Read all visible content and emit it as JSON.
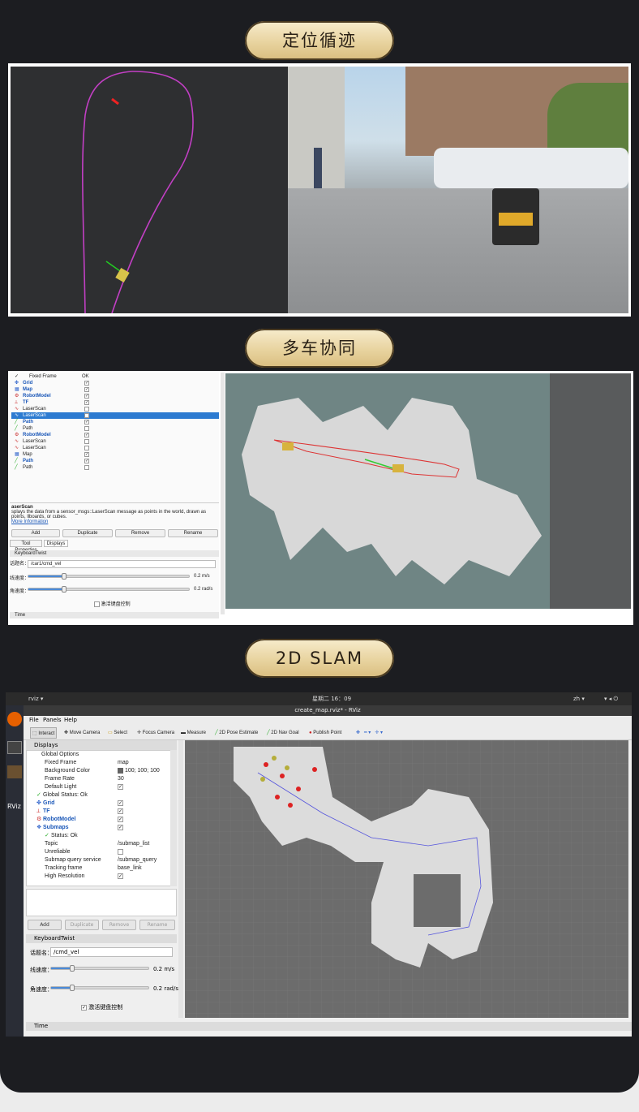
{
  "sections": [
    {
      "title": "定位循迹"
    },
    {
      "title": "多车协同"
    },
    {
      "title": "2D SLAM"
    }
  ],
  "panel2": {
    "display_rows": [
      {
        "name": "Fixed Frame",
        "value": "OK"
      },
      {
        "name": "Grid",
        "checked": "✓"
      },
      {
        "name": "Map",
        "checked": "✓"
      },
      {
        "name": "RobotModel",
        "checked": "✓"
      },
      {
        "name": "TF",
        "checked": "✓"
      },
      {
        "name": "LaserScan",
        "checked": ""
      },
      {
        "name": "LaserScan",
        "checked": ""
      },
      {
        "name": "Path",
        "checked": "✓"
      },
      {
        "name": "Path",
        "checked": ""
      },
      {
        "name": "RobotModel",
        "checked": "✓"
      },
      {
        "name": "LaserScan",
        "checked": ""
      },
      {
        "name": "LaserScan",
        "checked": ""
      },
      {
        "name": "Map",
        "checked": "✓"
      },
      {
        "name": "Path",
        "checked": "✓"
      },
      {
        "name": "Path",
        "checked": ""
      }
    ],
    "desc_title": "aserScan",
    "desc_text": "splays the data from a sensor_msgs::LaserScan message as points in the world, drawn as points, llboards, or cubes.",
    "desc_link": "More Information",
    "buttons": {
      "add": "Add",
      "duplicate": "Duplicate",
      "remove": "Remove",
      "rename": "Rename"
    },
    "tabs": {
      "tool_properties": "Tool Properties",
      "displays": "Displays"
    },
    "keyboard_title": "KeyboardTwist",
    "topic_label": "话题名：",
    "topic_value": "/car1/cmd_vel",
    "linear_label": "线速度：",
    "linear_value": "0.2 m/s",
    "linear_level": 0.22,
    "angular_label": "角速度：",
    "angular_value": "0.2 rad/s",
    "angular_level": 0.22,
    "activate_label": "激活键盘控制",
    "time_label": "Time"
  },
  "panel3": {
    "top_app": "rviz ▾",
    "clock": "星期二 16：09",
    "lang": "zh ▾",
    "window_title": "create_map.rviz* - RViz",
    "menu": {
      "file": "File",
      "panels": "Panels",
      "help": "Help"
    },
    "tools": {
      "interact": "Interact",
      "move_camera": "Move Camera",
      "select": "Select",
      "focus_camera": "Focus Camera",
      "measure": "Measure",
      "pose": "2D Pose Estimate",
      "nav": "2D Nav Goal",
      "publish": "Publish Point"
    },
    "displays_title": "Displays",
    "rows": [
      {
        "key": "Global Options",
        "value": ""
      },
      {
        "key": "Fixed Frame",
        "value": "map"
      },
      {
        "key": "Background Color",
        "value": "100; 100; 100"
      },
      {
        "key": "Frame Rate",
        "value": "30"
      },
      {
        "key": "Default Light",
        "value": "✓"
      },
      {
        "key": "Global Status: Ok",
        "value": ""
      },
      {
        "key": "Grid",
        "value": "✓"
      },
      {
        "key": "TF",
        "value": "✓"
      },
      {
        "key": "RobotModel",
        "value": "✓"
      },
      {
        "key": "Submaps",
        "value": "✓"
      },
      {
        "key": "Status: Ok",
        "value": ""
      },
      {
        "key": "Topic",
        "value": "/submap_list"
      },
      {
        "key": "Unreliable",
        "value": ""
      },
      {
        "key": "Submap query service",
        "value": "/submap_query"
      },
      {
        "key": "Tracking frame",
        "value": "base_link"
      },
      {
        "key": "High Resolution",
        "value": "✓"
      }
    ],
    "buttons": {
      "add": "Add",
      "duplicate": "Duplicate",
      "remove": "Remove",
      "rename": "Rename"
    },
    "keyboard_title": "KeyboardTwist",
    "topic_label": "话题名：",
    "topic_value": "/cmd_vel",
    "linear_label": "线速度：",
    "linear_value": "0.2 m/s",
    "linear_level": 0.22,
    "angular_label": "角速度：",
    "angular_value": "0.2 rad/s",
    "angular_level": 0.22,
    "activate_label": "激活键盘控制",
    "time_label": "Time",
    "launcher_label": "RViz"
  }
}
